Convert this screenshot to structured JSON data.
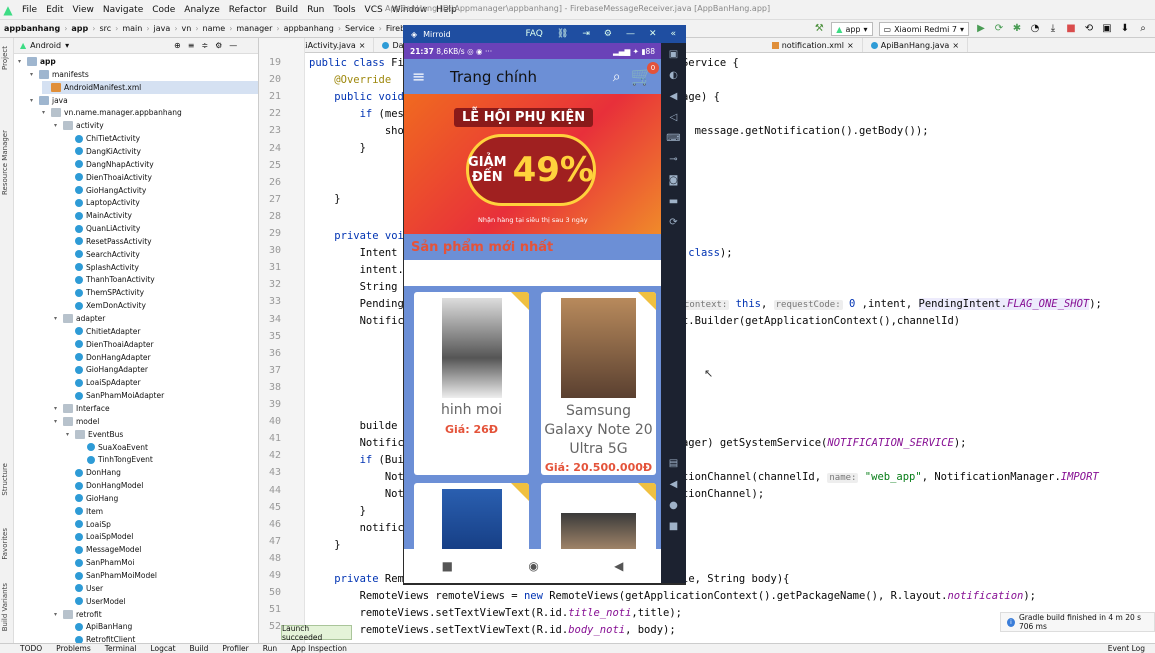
{
  "window_title": "AppBanHang [D:\\Appmanager\\appbanhang] - FirebaseMessageReceiver.java [AppBanHang.app]",
  "menu": [
    "File",
    "Edit",
    "View",
    "Navigate",
    "Code",
    "Analyze",
    "Refactor",
    "Build",
    "Run",
    "Tools",
    "VCS",
    "Window",
    "Help"
  ],
  "breadcrumb": [
    "appbanhang",
    "app",
    "src",
    "main",
    "java",
    "vn",
    "name",
    "manager",
    "appbanhang",
    "Service",
    "FirebaseMessage"
  ],
  "run_config": "app",
  "device": "Xiaomi Redmi 7",
  "project_view": "Android",
  "editor_tabs": [
    "DangKiActivity.java",
    "DangNh",
    "notification.xml",
    "ApiBanHang.java"
  ],
  "tree": [
    {
      "label": "app",
      "type": "folder",
      "indent": 0,
      "bold": true
    },
    {
      "label": "manifests",
      "type": "folder",
      "indent": 1
    },
    {
      "label": "AndroidManifest.xml",
      "type": "xml",
      "indent": 2,
      "selected": true
    },
    {
      "label": "java",
      "type": "folder",
      "indent": 1
    },
    {
      "label": "vn.name.manager.appbanhang",
      "type": "pkg",
      "indent": 2
    },
    {
      "label": "activity",
      "type": "pkg",
      "indent": 3
    },
    {
      "label": "ChiTietActivity",
      "type": "cls",
      "indent": 4
    },
    {
      "label": "DangKiActivity",
      "type": "cls",
      "indent": 4
    },
    {
      "label": "DangNhapActivity",
      "type": "cls",
      "indent": 4
    },
    {
      "label": "DienThoaiActivity",
      "type": "cls",
      "indent": 4
    },
    {
      "label": "GioHangActivity",
      "type": "cls",
      "indent": 4
    },
    {
      "label": "LaptopActivity",
      "type": "cls",
      "indent": 4
    },
    {
      "label": "MainActivity",
      "type": "cls",
      "indent": 4
    },
    {
      "label": "QuanLiActivity",
      "type": "cls",
      "indent": 4
    },
    {
      "label": "ResetPassActivity",
      "type": "cls",
      "indent": 4
    },
    {
      "label": "SearchActivity",
      "type": "cls",
      "indent": 4
    },
    {
      "label": "SplashActivity",
      "type": "cls",
      "indent": 4
    },
    {
      "label": "ThanhToanActivity",
      "type": "cls",
      "indent": 4
    },
    {
      "label": "ThemSPActivity",
      "type": "cls",
      "indent": 4
    },
    {
      "label": "XemDonActivity",
      "type": "cls",
      "indent": 4
    },
    {
      "label": "adapter",
      "type": "pkg",
      "indent": 3
    },
    {
      "label": "ChitietAdapter",
      "type": "cls",
      "indent": 4
    },
    {
      "label": "DienThoaiAdapter",
      "type": "cls",
      "indent": 4
    },
    {
      "label": "DonHangAdapter",
      "type": "cls",
      "indent": 4
    },
    {
      "label": "GioHangAdapter",
      "type": "cls",
      "indent": 4
    },
    {
      "label": "LoaiSpAdapter",
      "type": "cls",
      "indent": 4
    },
    {
      "label": "SanPhamMoiAdapter",
      "type": "cls",
      "indent": 4
    },
    {
      "label": "Interface",
      "type": "pkg",
      "indent": 3
    },
    {
      "label": "model",
      "type": "pkg",
      "indent": 3
    },
    {
      "label": "EventBus",
      "type": "pkg",
      "indent": 4
    },
    {
      "label": "SuaXoaEvent",
      "type": "cls",
      "indent": 5
    },
    {
      "label": "TinhTongEvent",
      "type": "cls",
      "indent": 5
    },
    {
      "label": "DonHang",
      "type": "cls",
      "indent": 4
    },
    {
      "label": "DonHangModel",
      "type": "cls",
      "indent": 4
    },
    {
      "label": "GioHang",
      "type": "cls",
      "indent": 4
    },
    {
      "label": "Item",
      "type": "cls",
      "indent": 4
    },
    {
      "label": "LoaiSp",
      "type": "cls",
      "indent": 4
    },
    {
      "label": "LoaiSpModel",
      "type": "cls",
      "indent": 4
    },
    {
      "label": "MessageModel",
      "type": "cls",
      "indent": 4
    },
    {
      "label": "SanPhamMoi",
      "type": "cls",
      "indent": 4
    },
    {
      "label": "SanPhamMoiModel",
      "type": "cls",
      "indent": 4
    },
    {
      "label": "User",
      "type": "cls",
      "indent": 4
    },
    {
      "label": "UserModel",
      "type": "cls",
      "indent": 4
    },
    {
      "label": "retrofit",
      "type": "pkg",
      "indent": 3
    },
    {
      "label": "ApiBanHang",
      "type": "cls",
      "indent": 4
    },
    {
      "label": "RetrofitClient",
      "type": "cls",
      "indent": 4
    }
  ],
  "left_strip": [
    "Project",
    "Resource Manager",
    "Structure",
    "Favorites",
    "Build Variants"
  ],
  "line_numbers": [
    "19",
    "20",
    "21",
    "22",
    "23",
    "24",
    "25",
    "26",
    "27",
    "28",
    "29",
    "30",
    "31",
    "32",
    "33",
    "34",
    "35",
    "36",
    "37",
    "38",
    "39",
    "40",
    "41",
    "42",
    "43",
    "44",
    "45",
    "46",
    "47",
    "48",
    "49",
    "50",
    "51",
    "52"
  ],
  "mirroid": {
    "title": "Mirroid",
    "time": "21:37",
    "speed": "8,6KB/s",
    "battery": "88",
    "app_title": "Trang chính",
    "cart_count": "0",
    "banner_title": "LỄ HỘI PHỤ KIỆN",
    "banner_giam": "GIẢM",
    "banner_den": "ĐẾN",
    "banner_percent": "49%",
    "banner_foot": "Nhận hàng tại siêu thị sau 3 ngày",
    "section": "Sản phẩm mới nhất",
    "products": [
      {
        "name": "hinh moi",
        "price": "Giá: 26Đ"
      },
      {
        "name": "Samsung Galaxy Note 20 Ultra 5G",
        "price": "Giá: 20.500.000Đ"
      },
      {
        "name": "",
        "price": ""
      },
      {
        "name": "",
        "price": ""
      }
    ]
  },
  "toast": "Launch succeeded",
  "notification": "Gradle build finished in 4 m 20 s 706 ms",
  "bottom_tabs": [
    "TODO",
    "Problems",
    "Terminal",
    "Logcat",
    "Build",
    "Profiler",
    "Run",
    "App Inspection"
  ],
  "event_log": "Event Log"
}
